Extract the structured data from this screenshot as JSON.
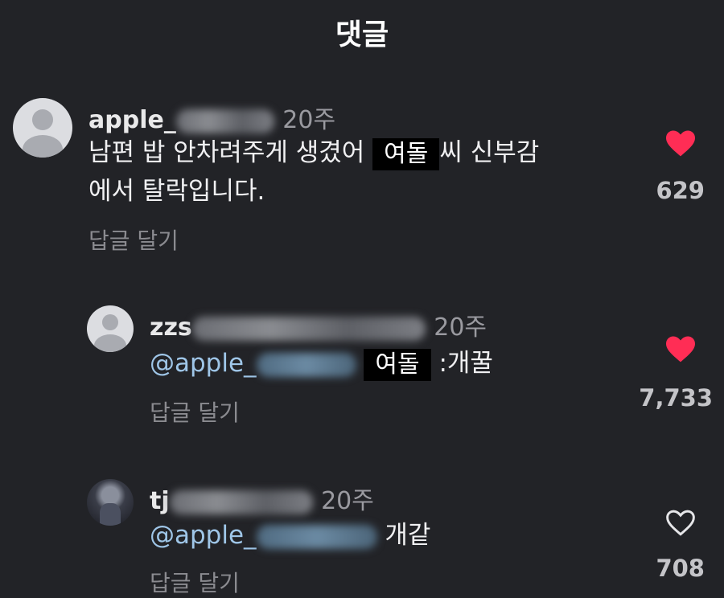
{
  "header": {
    "title": "댓글"
  },
  "comments": [
    {
      "username_visible": "apple_",
      "time": "20주",
      "text_before": "남편 밥 안차려주게 생겼어",
      "redacted": "여돌",
      "text_after": "씨  신부감",
      "text_line2": "에서 탈락입니다.",
      "reply_label": "답글 달기",
      "liked": true,
      "likes": "629"
    },
    {
      "username_visible": "zzs",
      "time": "20주",
      "mention": "@apple_",
      "redacted": "여돌",
      "text_after": ":개꿀",
      "reply_label": "답글 달기",
      "liked": true,
      "likes": "7,733"
    },
    {
      "username_visible": "tj",
      "time": "20주",
      "mention": "@apple_",
      "text_after": "개같",
      "reply_label": "답글 달기",
      "liked": false,
      "likes": "708"
    }
  ],
  "colors": {
    "background": "#222327",
    "heart": "#ff2d55",
    "mention": "#9fc6e8"
  }
}
